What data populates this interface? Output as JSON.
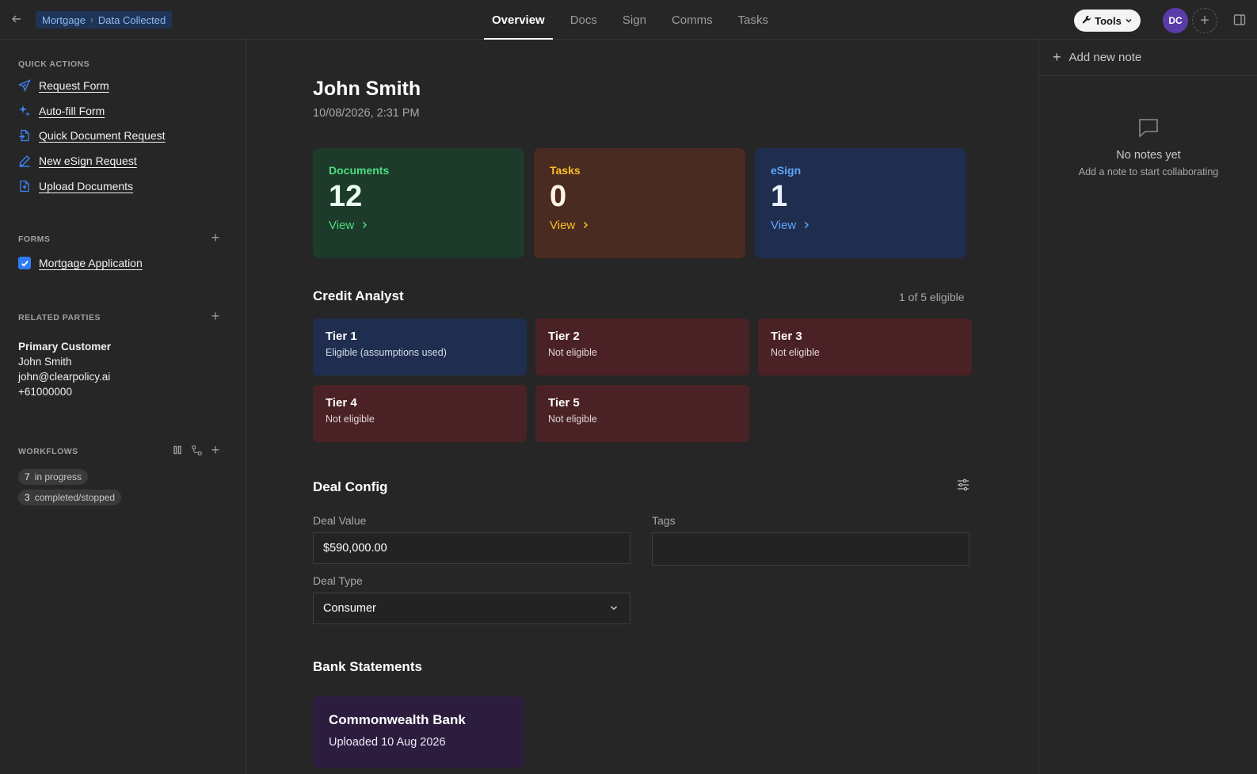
{
  "breadcrumb": {
    "parent": "Mortgage",
    "current": "Data Collected"
  },
  "tabs": [
    {
      "label": "Overview"
    },
    {
      "label": "Docs"
    },
    {
      "label": "Sign"
    },
    {
      "label": "Comms"
    },
    {
      "label": "Tasks"
    }
  ],
  "header": {
    "tools_label": "Tools",
    "avatar_initials": "DC"
  },
  "sidebar": {
    "quick_actions_title": "QUICK ACTIONS",
    "quick_actions": [
      {
        "label": "Request Form",
        "icon": "send-icon"
      },
      {
        "label": "Auto-fill Form",
        "icon": "sparkle-icon"
      },
      {
        "label": "Quick Document Request",
        "icon": "document-arrow-icon"
      },
      {
        "label": "New eSign Request",
        "icon": "pen-icon"
      },
      {
        "label": "Upload Documents",
        "icon": "document-upload-icon"
      }
    ],
    "forms_title": "FORMS",
    "forms": [
      {
        "label": "Mortgage Application",
        "checked": true
      }
    ],
    "related_parties_title": "RELATED PARTIES",
    "party": {
      "role": "Primary Customer",
      "name": "John Smith",
      "email": "john@clearpolicy.ai",
      "phone": "+61000000"
    },
    "workflows_title": "WORKFLOWS",
    "workflows": [
      {
        "count": "7",
        "label": "in progress"
      },
      {
        "count": "3",
        "label": "completed/stopped"
      }
    ]
  },
  "main": {
    "name": "John Smith",
    "date": "10/08/2026, 2:31 PM",
    "stats": [
      {
        "label": "Documents",
        "value": "12",
        "view": "View",
        "color": "#1d3a2a"
      },
      {
        "label": "Tasks",
        "value": "0",
        "view": "View",
        "color": "#4a2b22"
      },
      {
        "label": "eSign",
        "value": "1",
        "view": "View",
        "color": "#1f2d4e"
      }
    ],
    "credit": {
      "title": "Credit Analyst",
      "eligible_summary": "1 of 5 eligible",
      "tiers": [
        {
          "name": "Tier 1",
          "status": "Eligible (assumptions used)",
          "eligible": true
        },
        {
          "name": "Tier 2",
          "status": "Not eligible",
          "eligible": false
        },
        {
          "name": "Tier 3",
          "status": "Not eligible",
          "eligible": false
        },
        {
          "name": "Tier 4",
          "status": "Not eligible",
          "eligible": false
        },
        {
          "name": "Tier 5",
          "status": "Not eligible",
          "eligible": false
        }
      ]
    },
    "deal": {
      "title": "Deal Config",
      "deal_value_label": "Deal Value",
      "deal_value": "$590,000.00",
      "tags_label": "Tags",
      "tags_value": "",
      "deal_type_label": "Deal Type",
      "deal_type": "Consumer"
    },
    "bank": {
      "title": "Bank Statements",
      "cards": [
        {
          "bank": "Commonwealth Bank",
          "uploaded": "Uploaded 10 Aug 2026"
        }
      ]
    }
  },
  "notes": {
    "add_label": "Add new note",
    "empty_title": "No notes yet",
    "empty_subtitle": "Add a note to start collaborating"
  }
}
